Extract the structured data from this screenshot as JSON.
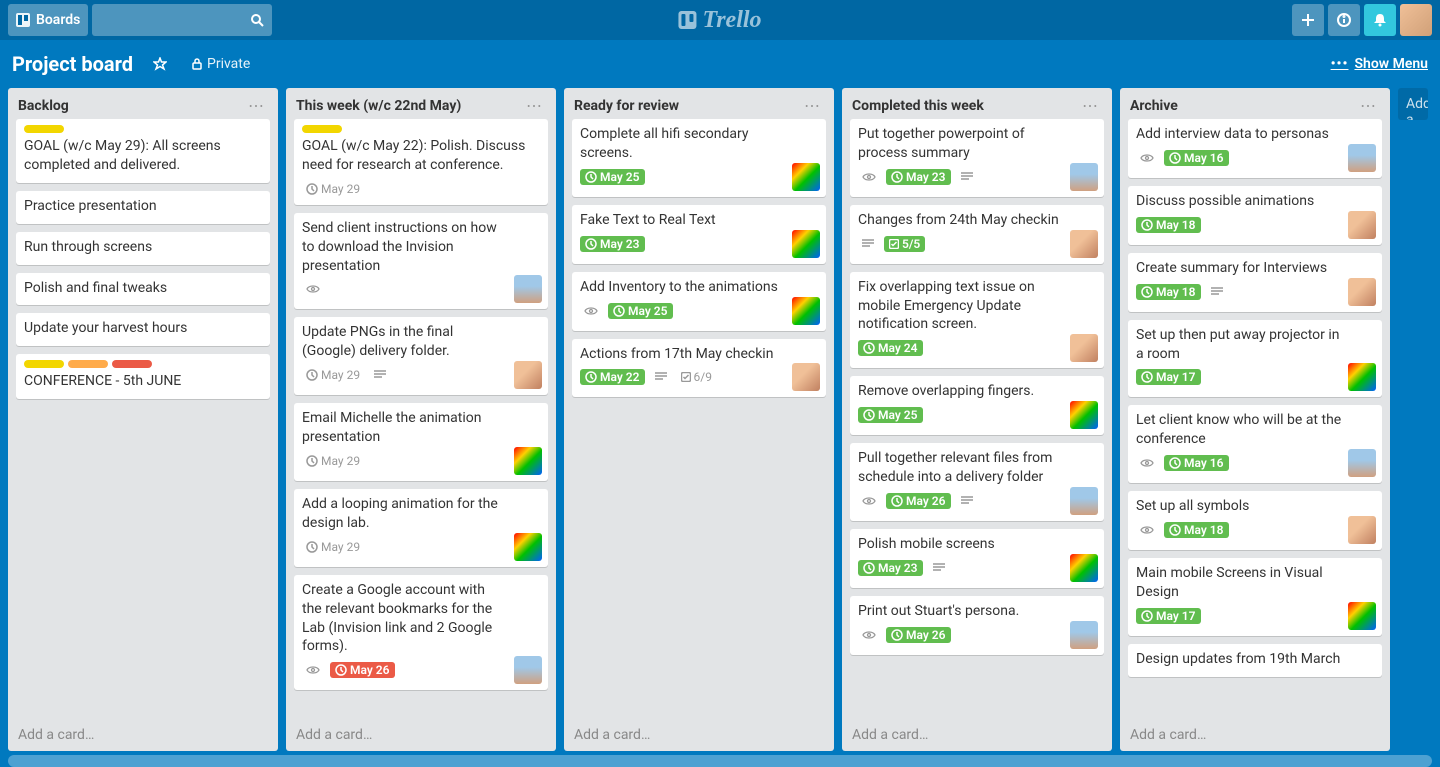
{
  "header": {
    "boards_label": "Boards",
    "app_name": "Trello"
  },
  "board": {
    "title": "Project board",
    "privacy": "Private",
    "show_menu": "Show Menu",
    "add_list": "Add a list…"
  },
  "add_card_label": "Add a card…",
  "lists": [
    {
      "title": "Backlog",
      "cards": [
        {
          "labels": [
            "yellow"
          ],
          "title": "GOAL (w/c May 29): All screens completed and delivered."
        },
        {
          "title": "Practice presentation"
        },
        {
          "title": "Run through screens"
        },
        {
          "title": "Polish and final tweaks"
        },
        {
          "title": "Update your harvest hours"
        },
        {
          "labels": [
            "yellow",
            "orange",
            "red"
          ],
          "title": "CONFERENCE - 5th JUNE"
        }
      ]
    },
    {
      "title": "This week (w/c 22nd May)",
      "cards": [
        {
          "labels": [
            "yellow"
          ],
          "title": "GOAL (w/c May 22): Polish. Discuss need for research at conference.",
          "due": "May 29",
          "due_neutral": true
        },
        {
          "title": "Send client instructions on how to download the Invision presentation",
          "watch": true,
          "member": "person2"
        },
        {
          "title": "Update PNGs in the final (Google) delivery folder.",
          "due": "May 29",
          "due_neutral": true,
          "desc": true,
          "member": "person1"
        },
        {
          "title": "Email Michelle the animation presentation",
          "due": "May 29",
          "due_neutral": true,
          "member": "rainbow"
        },
        {
          "title": "Add a looping animation for the design lab.",
          "due": "May 29",
          "due_neutral": true,
          "member": "rainbow"
        },
        {
          "title": "Create a Google account with the relevant bookmarks for the Lab (Invision link and 2 Google forms).",
          "watch": true,
          "due": "May 26",
          "due_red": true,
          "member": "person2"
        }
      ]
    },
    {
      "title": "Ready for review",
      "cards": [
        {
          "title": "Complete all hifi secondary screens.",
          "due": "May 25",
          "member": "rainbow"
        },
        {
          "title": "Fake Text to Real Text",
          "due": "May 23",
          "member": "rainbow"
        },
        {
          "title": "Add Inventory to the animations",
          "watch": true,
          "due": "May 25",
          "member": "rainbow"
        },
        {
          "title": "Actions from 17th May checkin",
          "due": "May 22",
          "desc": true,
          "check": "6/9",
          "member": "person1"
        }
      ]
    },
    {
      "title": "Completed this week",
      "cards": [
        {
          "title": "Put together powerpoint of process summary",
          "watch": true,
          "due": "May 23",
          "desc": true,
          "member": "person2"
        },
        {
          "title": "Changes from 24th May checkin",
          "desc": true,
          "check": "5/5",
          "check_done": true,
          "member": "person1"
        },
        {
          "title": "Fix overlapping text issue on mobile Emergency Update notification screen.",
          "due": "May 24",
          "member": "person1"
        },
        {
          "title": "Remove overlapping fingers.",
          "due": "May 25",
          "member": "rainbow"
        },
        {
          "title": "Pull together relevant files from schedule into a delivery folder",
          "watch": true,
          "due": "May 26",
          "desc": true,
          "member": "person2"
        },
        {
          "title": "Polish mobile screens",
          "due": "May 23",
          "desc": true,
          "member": "rainbow"
        },
        {
          "title": "Print out Stuart's persona.",
          "watch": true,
          "due": "May 26",
          "member": "person2"
        }
      ]
    },
    {
      "title": "Archive",
      "cards": [
        {
          "title": "Add interview data to personas",
          "watch": true,
          "due": "May 16",
          "member": "person2"
        },
        {
          "title": "Discuss possible animations",
          "due": "May 18",
          "member": "person1"
        },
        {
          "title": "Create summary for Interviews",
          "due": "May 18",
          "desc": true,
          "member": "person1"
        },
        {
          "title": "Set up then put away projector in a room",
          "due": "May 17",
          "member": "rainbow"
        },
        {
          "title": "Let client know who will be at the conference",
          "watch": true,
          "due": "May 16",
          "member": "person2"
        },
        {
          "title": "Set up all symbols",
          "watch": true,
          "due": "May 18",
          "member": "person1"
        },
        {
          "title": "Main mobile Screens in Visual Design",
          "due": "May 17",
          "member": "rainbow"
        },
        {
          "title": "Design updates from 19th March"
        }
      ]
    }
  ]
}
